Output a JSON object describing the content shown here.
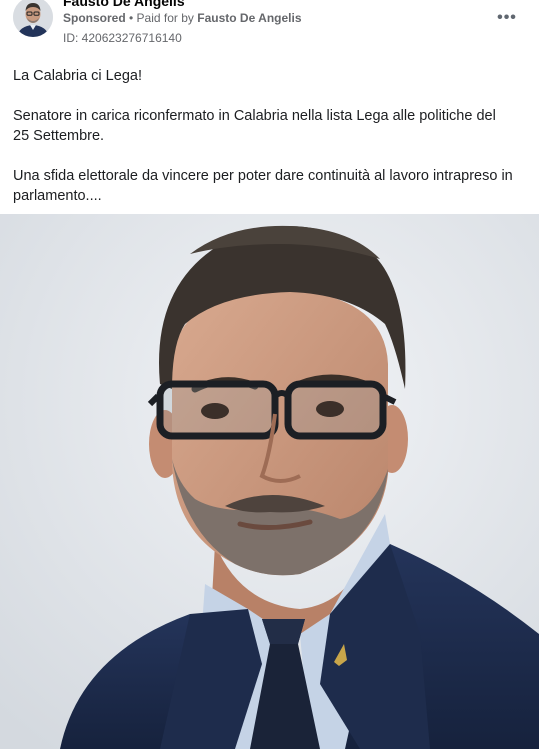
{
  "post": {
    "author": {
      "name": "Fausto De Angelis",
      "avatar_icon": "person-avatar"
    },
    "sponsor_line": {
      "sponsored": "Sponsored",
      "separator": " • ",
      "paid_for_prefix": "Paid for by ",
      "paid_for_name": "Fausto De Angelis"
    },
    "ad_id": "ID: 420623276716140",
    "more_icon": "more-horizontal-icon",
    "more_glyph": "•••",
    "text": {
      "line1": "La Calabria ci Lega!",
      "line2": "Senatore in carica riconfermato in Calabria nella lista Lega alle politiche del 25 Settembre.",
      "line3": "Una sfida elettorale da vincere per poter dare continuità al lavoro intrapreso in parlamento...."
    },
    "image": {
      "subject": "portrait-photo"
    }
  },
  "colors": {
    "text_primary": "#1c1e21",
    "text_secondary": "#65676b",
    "suit": "#1f2e4f",
    "background": "#e6e9ed"
  }
}
